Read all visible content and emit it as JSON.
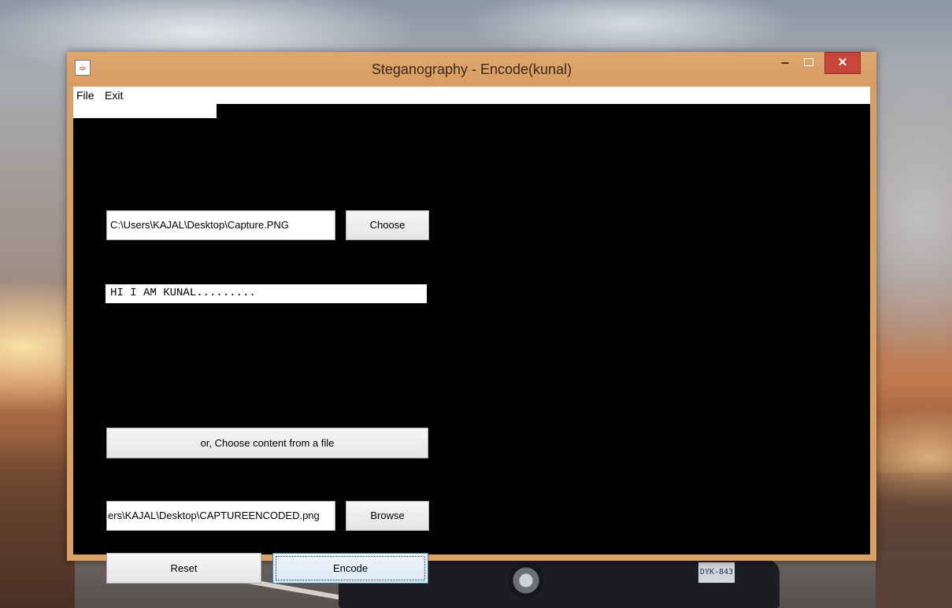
{
  "window": {
    "title": "Steganography - Encode(kunal)",
    "controls": {
      "minimize": "–",
      "close": "✕"
    }
  },
  "menu": {
    "file": "File",
    "exit": "Exit"
  },
  "form": {
    "image_path": "C:\\Users\\KAJAL\\Desktop\\Capture.PNG",
    "choose_label": "Choose",
    "message": "HI I AM KUNAL.........",
    "choose_content_label": "or, Choose content from a file",
    "output_path": "ers\\KAJAL\\Desktop\\CAPTUREENCODED.png",
    "browse_label": "Browse",
    "reset_label": "Reset",
    "encode_label": "Encode"
  },
  "wallpaper": {
    "plate": "DYK-843"
  },
  "colors": {
    "titlebar": "#d9a066",
    "close_button": "#c8453a",
    "content_background": "#000000",
    "focused_button_border": "#3c7fb1"
  },
  "icons": {
    "app": "java-coffee-icon",
    "maximize": "maximize-icon"
  }
}
